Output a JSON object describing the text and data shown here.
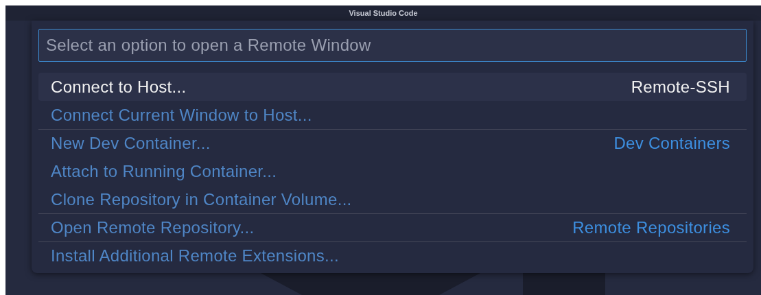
{
  "window": {
    "title": "Visual Studio Code"
  },
  "quick_pick": {
    "placeholder": "Select an option to open a Remote Window",
    "items": [
      {
        "label": "Connect to Host...",
        "group": "Remote-SSH",
        "separator": false,
        "selected": true
      },
      {
        "label": "Connect Current Window to Host...",
        "separator": false,
        "selected": false
      },
      {
        "label": "New Dev Container...",
        "group": "Dev Containers",
        "separator": true,
        "selected": false
      },
      {
        "label": "Attach to Running Container...",
        "separator": false,
        "selected": false
      },
      {
        "label": "Clone Repository in Container Volume...",
        "separator": false,
        "selected": false
      },
      {
        "label": "Open Remote Repository...",
        "group": "Remote Repositories",
        "separator": true,
        "selected": false
      },
      {
        "label": "Install Additional Remote Extensions...",
        "separator": true,
        "selected": false
      }
    ]
  }
}
